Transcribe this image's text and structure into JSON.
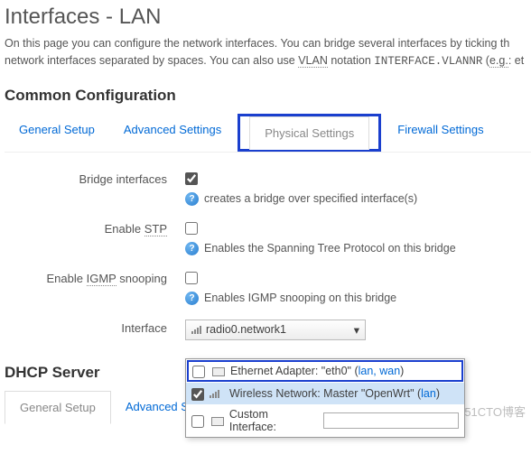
{
  "header": {
    "title": "Interfaces - LAN",
    "desc_a": "On this page you can configure the network interfaces. You can bridge several interfaces by ticking th",
    "desc_b": "network interfaces separated by spaces. You can also use ",
    "desc_vlan": "VLAN",
    "desc_c": " notation ",
    "desc_code": "INTERFACE.VLANNR",
    "desc_d": " (",
    "desc_eg": "e.g.",
    "desc_e": ": et"
  },
  "section1": {
    "title": "Common Configuration"
  },
  "tabs": {
    "general": "General Setup",
    "advanced": "Advanced Settings",
    "physical": "Physical Settings",
    "firewall": "Firewall Settings"
  },
  "fields": {
    "bridge": {
      "label": "Bridge interfaces",
      "hint": "creates a bridge over specified interface(s)"
    },
    "stp": {
      "label_a": "Enable ",
      "label_u": "STP",
      "hint": "Enables the Spanning Tree Protocol on this bridge"
    },
    "igmp": {
      "label_a": "Enable ",
      "label_u": "IGMP",
      "label_b": " snooping",
      "hint": "Enables IGMP snooping on this bridge"
    },
    "iface": {
      "label": "Interface",
      "selected": "radio0.network1"
    }
  },
  "dropdown": {
    "opt1_a": "Ethernet Adapter: \"eth0\" (",
    "opt1_links": "lan, wan",
    "opt1_b": ")",
    "opt2_a": "Wireless Network: Master \"OpenWrt\" (",
    "opt2_links": "lan",
    "opt2_b": ")",
    "opt3": "Custom Interface:"
  },
  "section2": {
    "title": "DHCP Server"
  },
  "tabs2": {
    "general": "General Setup",
    "advanced": "Advanced S"
  },
  "watermark": "@51CTO博客"
}
